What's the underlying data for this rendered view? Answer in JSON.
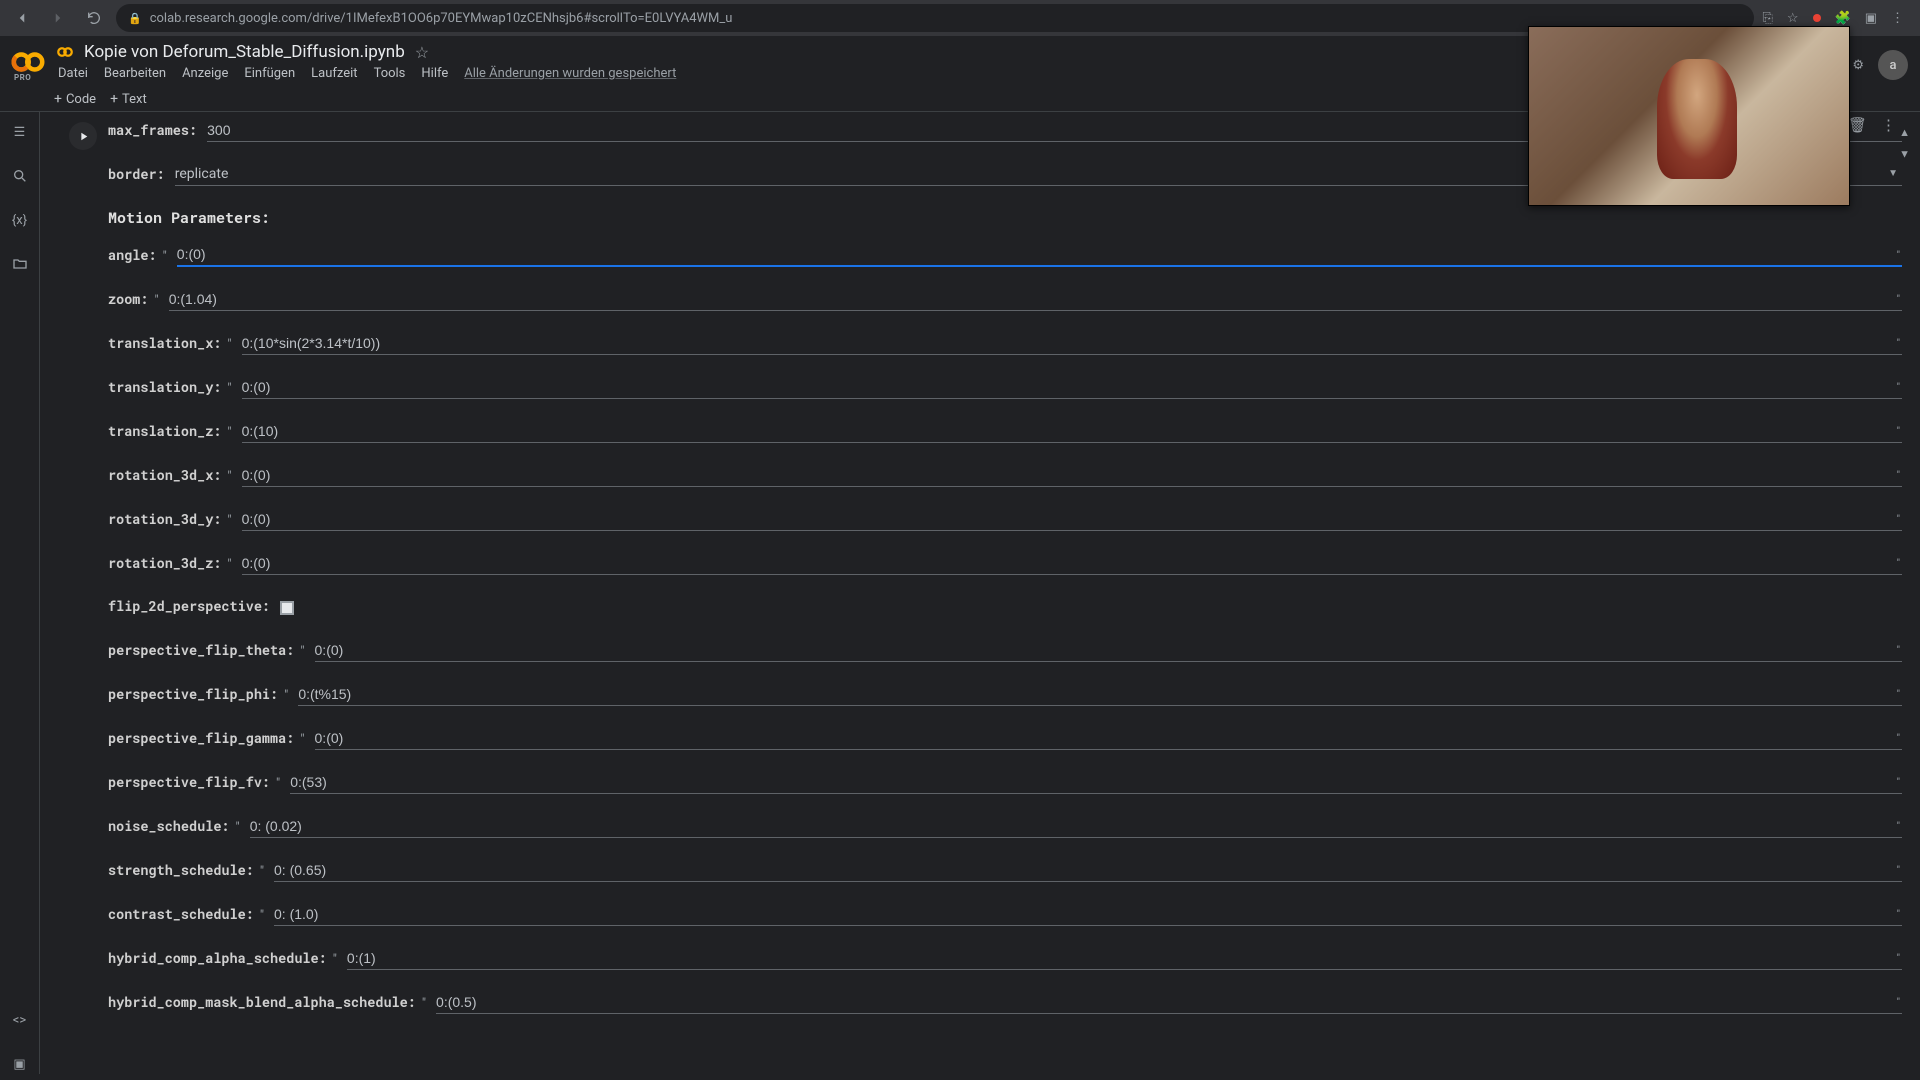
{
  "browser": {
    "url": "colab.research.google.com/drive/1IMefexB1OO6p70EYMwap10zCENhsjb6#scrollTo=E0LVYA4WM_u",
    "avatar_letter": "a"
  },
  "header": {
    "title": "Kopie von Deforum_Stable_Diffusion.ipynb",
    "pro_label": "PRO",
    "menus": [
      "Datei",
      "Bearbeiten",
      "Anzeige",
      "Einfügen",
      "Laufzeit",
      "Tools",
      "Hilfe"
    ],
    "save_status": "Alle Änderungen wurden gespeichert",
    "avatar_letter": "a"
  },
  "toolbar": {
    "code_label": "Code",
    "text_label": "Text"
  },
  "section_heading": "Motion Parameters:",
  "fields": {
    "max_frames": {
      "label": "max_frames:",
      "value": "300"
    },
    "border": {
      "label": "border:",
      "value": "replicate"
    },
    "angle": {
      "label": "angle:",
      "value": "0:(0)"
    },
    "zoom": {
      "label": "zoom:",
      "value": "0:(1.04)"
    },
    "translation_x": {
      "label": "translation_x:",
      "value": "0:(10*sin(2*3.14*t/10))"
    },
    "translation_y": {
      "label": "translation_y:",
      "value": "0:(0)"
    },
    "translation_z": {
      "label": "translation_z:",
      "value": "0:(10)"
    },
    "rotation_3d_x": {
      "label": "rotation_3d_x:",
      "value": "0:(0)"
    },
    "rotation_3d_y": {
      "label": "rotation_3d_y:",
      "value": "0:(0)"
    },
    "rotation_3d_z": {
      "label": "rotation_3d_z:",
      "value": "0:(0)"
    },
    "flip_2d_perspective": {
      "label": "flip_2d_perspective:"
    },
    "perspective_flip_theta": {
      "label": "perspective_flip_theta:",
      "value": "0:(0)"
    },
    "perspective_flip_phi": {
      "label": "perspective_flip_phi:",
      "value": "0:(t%15)"
    },
    "perspective_flip_gamma": {
      "label": "perspective_flip_gamma:",
      "value": "0:(0)"
    },
    "perspective_flip_fv": {
      "label": "perspective_flip_fv:",
      "value": "0:(53)"
    },
    "noise_schedule": {
      "label": "noise_schedule:",
      "value": "0: (0.02)"
    },
    "strength_schedule": {
      "label": "strength_schedule:",
      "value": "0: (0.65)"
    },
    "contrast_schedule": {
      "label": "contrast_schedule:",
      "value": "0: (1.0)"
    },
    "hybrid_comp_alpha_schedule": {
      "label": "hybrid_comp_alpha_schedule:",
      "value": "0:(1)"
    },
    "hybrid_comp_mask_blend_alpha_schedule": {
      "label": "hybrid_comp_mask_blend_alpha_schedule:",
      "value": "0:(0.5)"
    }
  }
}
